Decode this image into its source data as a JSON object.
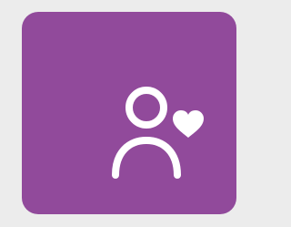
{
  "tile": {
    "background_color": "#914a9b",
    "page_background_color": "#ececec",
    "icon": {
      "name": "user-heart-icon",
      "color": "#ffffff"
    }
  }
}
